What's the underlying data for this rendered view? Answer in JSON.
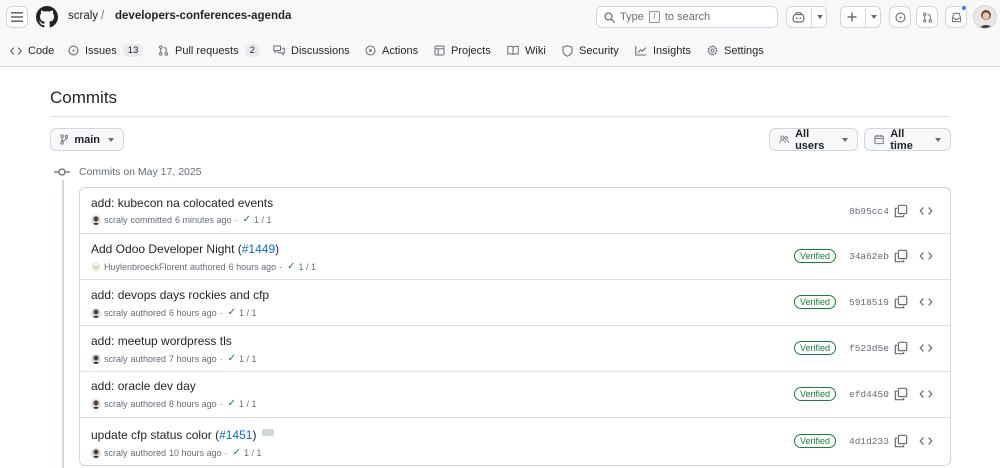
{
  "header": {
    "owner": "scraly",
    "separator": "/",
    "repo": "developers-conferences-agenda",
    "search_prefix": "Type",
    "search_key": "/",
    "search_suffix": "to search"
  },
  "nav": {
    "tabs": [
      {
        "label": "Code",
        "icon": "code-icon"
      },
      {
        "label": "Issues",
        "icon": "issue-opened-icon",
        "count": "13"
      },
      {
        "label": "Pull requests",
        "icon": "git-pull-request-icon",
        "count": "2"
      },
      {
        "label": "Discussions",
        "icon": "comment-discussion-icon"
      },
      {
        "label": "Actions",
        "icon": "play-icon"
      },
      {
        "label": "Projects",
        "icon": "table-icon"
      },
      {
        "label": "Wiki",
        "icon": "book-icon"
      },
      {
        "label": "Security",
        "icon": "shield-icon"
      },
      {
        "label": "Insights",
        "icon": "graph-icon"
      },
      {
        "label": "Settings",
        "icon": "gear-icon"
      }
    ]
  },
  "page": {
    "title": "Commits",
    "branch": "main",
    "users_filter": "All users",
    "time_filter": "All time",
    "group_heading": "Commits on May 17, 2025"
  },
  "colors": {
    "accent_link": "#0969da",
    "verified_green": "#1a7f37",
    "muted_text": "#656d76",
    "border": "#d0d7de"
  },
  "commits": [
    {
      "message": "add: kubecon na colocated events",
      "pr": "",
      "author": "scraly",
      "action": "committed",
      "time": "6 minutes ago",
      "checks": "1 / 1",
      "verified": "",
      "sha": "8b95cc4"
    },
    {
      "message": "Add Odoo Developer Night (",
      "pr": "#1449",
      "suffix": ")",
      "author": "HuylenbroeckFlorent",
      "action": "authored",
      "time": "6 hours ago",
      "checks": "1 / 1",
      "verified": "Verified",
      "sha": "34a62eb"
    },
    {
      "message": "add: devops days rockies and cfp",
      "pr": "",
      "author": "scraly",
      "action": "authored",
      "time": "6 hours ago",
      "checks": "1 / 1",
      "verified": "Verified",
      "sha": "5918519"
    },
    {
      "message": "add: meetup wordpress tls",
      "pr": "",
      "author": "scraly",
      "action": "authored",
      "time": "7 hours ago",
      "checks": "1 / 1",
      "verified": "Verified",
      "sha": "f523d5e"
    },
    {
      "message": "add: oracle dev day",
      "pr": "",
      "author": "scraly",
      "action": "authored",
      "time": "8 hours ago",
      "checks": "1 / 1",
      "verified": "Verified",
      "sha": "efd4450"
    },
    {
      "message": "update cfp status color (",
      "pr": "#1451",
      "suffix": ")",
      "author": "scraly",
      "action": "authored",
      "time": "10 hours ago",
      "checks": "1 / 1",
      "verified": "Verified",
      "sha": "4d1d233"
    }
  ]
}
